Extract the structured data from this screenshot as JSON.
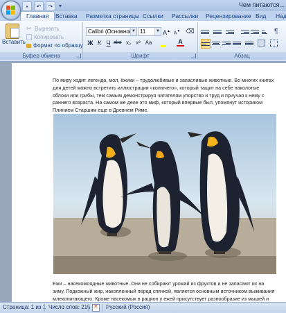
{
  "window": {
    "title": "Чем питаются..."
  },
  "tabs": [
    "Главная",
    "Вставка",
    "Разметка страницы",
    "Ссылки",
    "Рассылки",
    "Рецензирование",
    "Вид",
    "Над"
  ],
  "clipboard": {
    "paste_label": "Вставить",
    "cut_label": "Вырезать",
    "copy_label": "Копировать",
    "format_painter_label": "Формат по образцу",
    "group_label": "Буфер обмена"
  },
  "font": {
    "name_value": "Calibri (Основной тек",
    "size_value": "11",
    "group_label": "Шрифт",
    "bold": "Ж",
    "italic": "К",
    "underline": "Ч",
    "strike": "abe",
    "subscript": "x₂",
    "superscript": "x²",
    "change_case": "Aa",
    "grow": "A",
    "shrink": "A"
  },
  "paragraph": {
    "group_label": "Абзац"
  },
  "document": {
    "paragraph1": "По миру ходит легенда, мол, ёжики – трудолюбивые и запасливые животные.  Во многих книгах для детей можно встретить иллюстрации «колючего», который тащит на себе наколотые яблоки или грибы, тем самым демонстрируя читателям упорство и труд и приучая к нему с раннего возраста. На самом же деле  это миф, который впервые был, упомянут историком Плинием Старшим еще в Древнем Риме.",
    "paragraph2": "Ежи – насекомоядные животные. Они не собирают урожай из фруктов и не запасают их на зиму. Подкожный жир, накопленный перед спячкой, является основным источником выживания млекопитающего. Кроме насекомых в рацион у ежей присутствует разнообразие из мышей и"
  },
  "status": {
    "page": "Страница: 1 из 1",
    "words": "Число слов: 215",
    "language": "Русский (Россия)"
  },
  "colors": {
    "highlight": "#ffff00",
    "font_color": "#e00000",
    "accent": "#15428b"
  }
}
